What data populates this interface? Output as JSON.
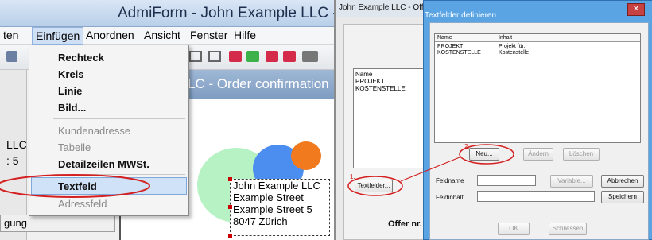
{
  "left": {
    "title": "AdmiForm - John Example LLC - Order c",
    "menu": [
      "ten",
      "Einfügen",
      "Anordnen",
      "Ansicht",
      "Fenster",
      "Hilfe"
    ],
    "doc_banner": "LC - Order confirmation",
    "sidebar": [
      "LLC",
      ": 5",
      "gung"
    ],
    "dropdown": {
      "items": [
        "Rechteck",
        "Kreis",
        "Linie",
        "Bild...",
        "Kundenadresse",
        "Tabelle",
        "Detailzeilen MWSt.",
        "Textfeld",
        "Adressfeld"
      ],
      "disabled": [
        "Kundenadresse",
        "Tabelle",
        "Adressfeld"
      ]
    },
    "address": [
      "John Example LLC",
      "Example Street",
      "Example Street 5",
      "8047 Zürich"
    ]
  },
  "right": {
    "window_title": "John Example LLC - Offer (Erste Seite)",
    "fields_box": {
      "header": "Name",
      "rows": [
        "PROJEKT",
        "KOSTENSTELLE"
      ]
    },
    "textfelder_button": "Textfelder...",
    "offer_label": "Offer nr.",
    "annot1": "1.",
    "annot2": "2.",
    "dialog": {
      "title": "Textfelder definieren",
      "columns": [
        "Name",
        "Inhalt"
      ],
      "rows": [
        [
          "PROJEKT",
          "Projekt für."
        ],
        [
          "KOSTENSTELLE",
          "Kostenstelle"
        ]
      ],
      "buttons": {
        "new": "Neu...",
        "edit": "Ändern",
        "delete": "Löschen",
        "variable": "Variable...",
        "cancel": "Abbrechen",
        "save": "Speichern",
        "ok": "OK",
        "close": "Schliessen"
      },
      "fields": {
        "name_label": "Feldname",
        "content_label": "Feldinhalt"
      }
    }
  },
  "colors": {
    "accent": "#5aa4e4",
    "highlight": "#d42020"
  }
}
